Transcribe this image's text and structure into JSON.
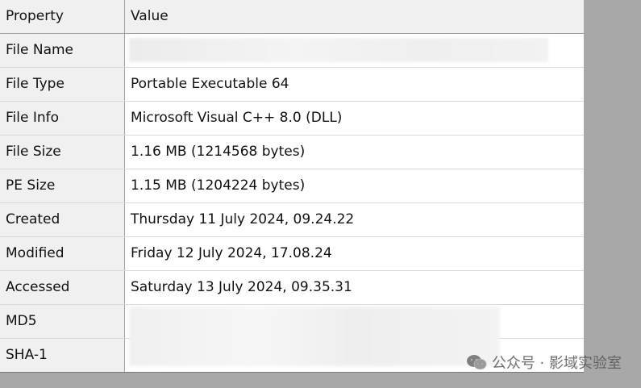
{
  "table": {
    "header": {
      "property": "Property",
      "value": "Value"
    },
    "rows": [
      {
        "property": "File Name",
        "value": "",
        "redacted": true
      },
      {
        "property": "File Type",
        "value": "Portable Executable 64"
      },
      {
        "property": "File Info",
        "value": "Microsoft Visual C++ 8.0 (DLL)"
      },
      {
        "property": "File Size",
        "value": "1.16 MB (1214568 bytes)"
      },
      {
        "property": "PE Size",
        "value": "1.15 MB (1204224 bytes)"
      },
      {
        "property": "Created",
        "value": "Thursday 11 July 2024, 09.24.22"
      },
      {
        "property": "Modified",
        "value": "Friday 12 July 2024, 17.08.24"
      },
      {
        "property": "Accessed",
        "value": "Saturday 13 July 2024, 09.35.31"
      },
      {
        "property": "MD5",
        "value": "",
        "redacted": true
      },
      {
        "property": "SHA-1",
        "value": "",
        "redacted": true
      }
    ]
  },
  "watermark": {
    "text": "公众号 · 影域实验室",
    "icon": "wechat-icon"
  },
  "colors": {
    "background": "#a8a8a8",
    "header_bg": "#f0f0f0",
    "property_col_bg": "#f0f0f0",
    "value_col_bg": "#ffffff",
    "grid_line": "#d9d9d9"
  }
}
